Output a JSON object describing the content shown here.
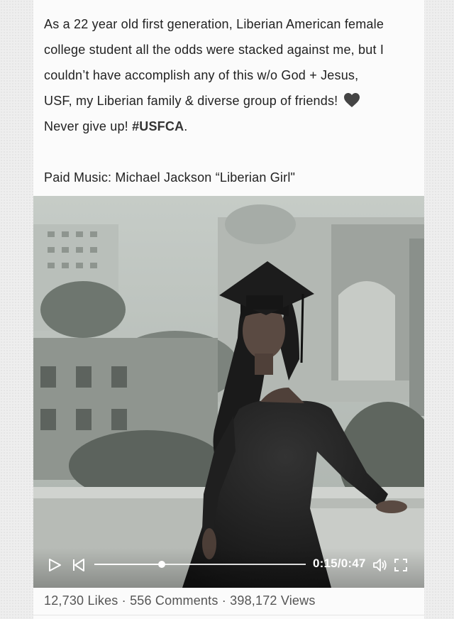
{
  "post": {
    "caption": {
      "line1": "As a 22 year old first generation, Liberian American female",
      "line2": "college student all the odds were stacked against me, but I",
      "line3": "couldn’t have accomplish any of this w/o God + Jesus,",
      "line4": "USF, my Liberian family & diverse group of friends!",
      "line5": "Never give up! ",
      "hashtag": "#USFCA",
      "line5_end": ".",
      "heart_icon": "black-heart-emoji",
      "music": "Paid Music: Michael Jackson “Liberian Girl\""
    },
    "video": {
      "time": "0:15/0:47",
      "progress_fraction": 0.319,
      "controls": [
        "play-icon",
        "rewind-icon",
        "volume-icon",
        "fullscreen-icon"
      ]
    },
    "stats": {
      "likes": "12,730 Likes",
      "separator": " · ",
      "comments": "556 Comments",
      "views": "398,172 Views"
    }
  }
}
